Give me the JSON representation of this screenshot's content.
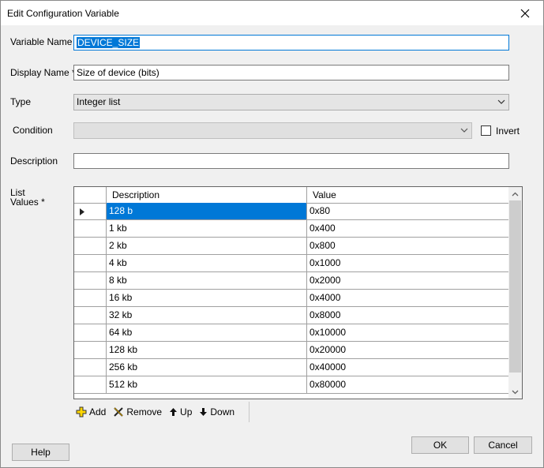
{
  "window": {
    "title": "Edit Configuration Variable"
  },
  "fields": {
    "variable_name": {
      "label": "Variable Name *",
      "value": "DEVICE_SIZE"
    },
    "display_name": {
      "label": "Display Name *",
      "value": "Size of device (bits)"
    },
    "type": {
      "label": "Type",
      "value": "Integer list"
    },
    "condition": {
      "label": "Condition",
      "value": ""
    },
    "invert": {
      "label": "Invert",
      "checked": false
    },
    "description": {
      "label": "Description",
      "value": ""
    },
    "list_values": {
      "label_line1": "List",
      "label_line2": "Values *"
    }
  },
  "grid": {
    "columns": [
      "Description",
      "Value"
    ],
    "rows": [
      {
        "description": "128 b",
        "value": "0x80"
      },
      {
        "description": "1 kb",
        "value": "0x400"
      },
      {
        "description": "2 kb",
        "value": "0x800"
      },
      {
        "description": "4 kb",
        "value": "0x1000"
      },
      {
        "description": "8 kb",
        "value": "0x2000"
      },
      {
        "description": "16 kb",
        "value": "0x4000"
      },
      {
        "description": "32 kb",
        "value": "0x8000"
      },
      {
        "description": "64 kb",
        "value": "0x10000"
      },
      {
        "description": "128 kb",
        "value": "0x20000"
      },
      {
        "description": "256 kb",
        "value": "0x40000"
      },
      {
        "description": "512 kb",
        "value": "0x80000"
      }
    ]
  },
  "toolbar": {
    "add": "Add",
    "remove": "Remove",
    "up": "Up",
    "down": "Down"
  },
  "buttons": {
    "help": "Help",
    "ok": "OK",
    "cancel": "Cancel"
  }
}
